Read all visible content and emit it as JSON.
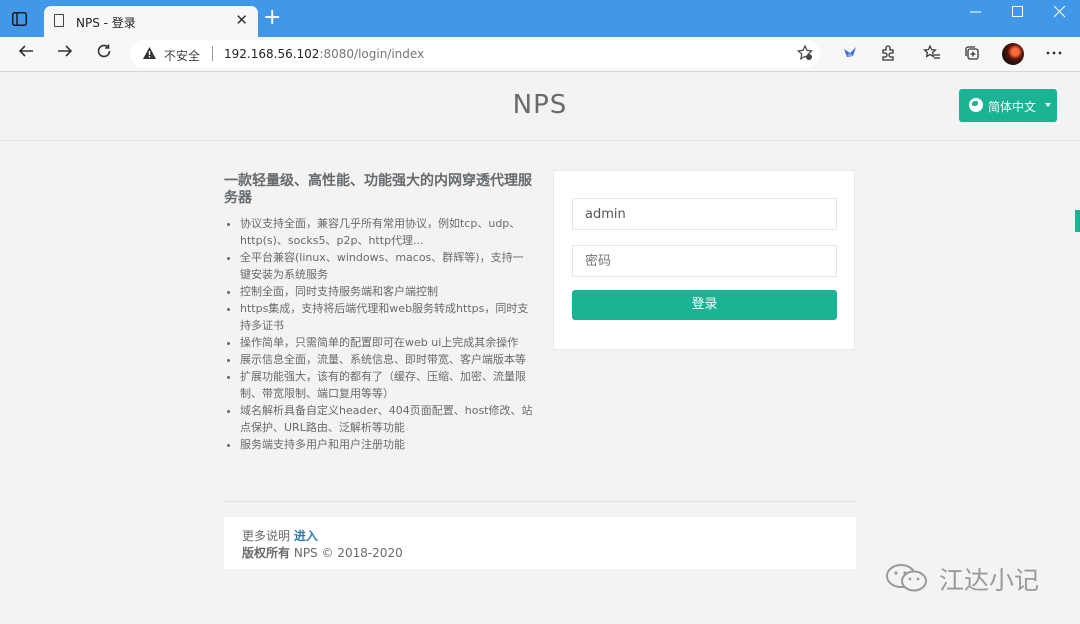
{
  "browser": {
    "tab_title": "NPS - 登录",
    "tab_close": "✕",
    "new_tab": "+",
    "security_label": "不安全",
    "url_host": "192.168.56.102",
    "url_rest": ":8080/login/index",
    "icons": [
      "sidebar-icon",
      "page-icon",
      "back-icon",
      "forward-icon",
      "refresh-icon",
      "warning-icon",
      "favorite-add-icon",
      "bird-icon",
      "extensions-icon",
      "favorites-icon",
      "collections-icon",
      "profile-avatar",
      "more-icon"
    ]
  },
  "header": {
    "brand": "NPS",
    "language_button": "简体中文"
  },
  "intro": {
    "title": "一款轻量级、高性能、功能强大的内网穿透代理服务器",
    "features": [
      "协议支持全面，兼容几乎所有常用协议，例如tcp、udp、http(s)、socks5、p2p、http代理...",
      "全平台兼容(linux、windows、macos、群辉等)，支持一键安装为系统服务",
      "控制全面，同时支持服务端和客户端控制",
      "https集成，支持将后端代理和web服务转成https，同时支持多证书",
      "操作简单，只需简单的配置即可在web ui上完成其余操作",
      "展示信息全面，流量、系统信息、即时带宽、客户端版本等",
      "扩展功能强大，该有的都有了（缓存、压缩、加密、流量限制、带宽限制、端口复用等等）",
      "域名解析具备自定义header、404页面配置、host修改、站点保护、URL路由、泛解析等功能",
      "服务端支持多用户和用户注册功能"
    ]
  },
  "login": {
    "username_value": "admin",
    "password_placeholder": "密码",
    "submit_label": "登录"
  },
  "footer": {
    "more_label": "更多说明",
    "more_link": "进入",
    "copyright_bold": "版权所有",
    "copyright_text": "NPS © 2018-2020"
  },
  "watermark": {
    "text": "江达小记"
  }
}
